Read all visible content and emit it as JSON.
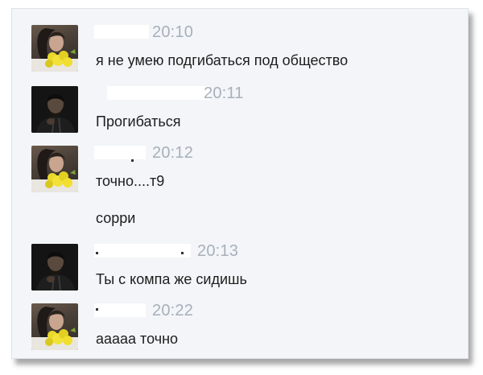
{
  "messages": [
    {
      "sender": "girl",
      "time": "20:10",
      "lines": [
        "я не умею подгибаться под общество"
      ]
    },
    {
      "sender": "man",
      "time": "20:11",
      "lines": [
        "Прогибаться"
      ]
    },
    {
      "sender": "girl",
      "time": "20:12",
      "lines": [
        "точно....т9",
        "сорри"
      ]
    },
    {
      "sender": "man",
      "time": "20:13",
      "lines": [
        "Ты с компа же сидишь"
      ]
    },
    {
      "sender": "girl",
      "time": "20:22",
      "lines": [
        "ааааа точно"
      ]
    }
  ]
}
